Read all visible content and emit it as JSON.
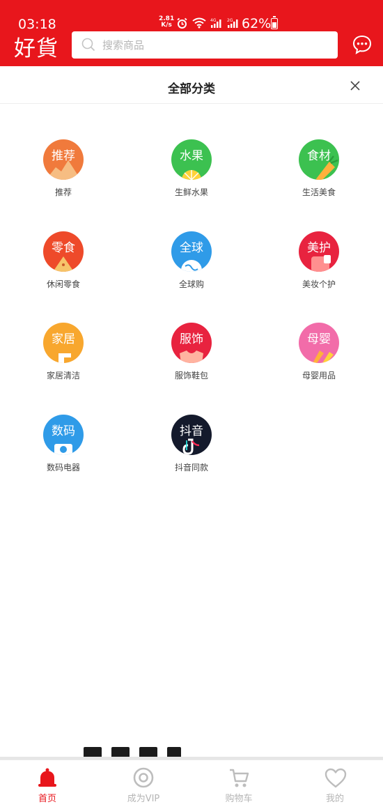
{
  "status_bar": {
    "time": "03:18",
    "speed_value": "2.81",
    "speed_unit": "K/s",
    "network": "4G 2G",
    "battery": "62%"
  },
  "header": {
    "logo": "好貨",
    "search_placeholder": "搜索商品",
    "message_icon": "chat-bubble-icon"
  },
  "panel": {
    "title": "全部分类",
    "close_icon": "close-icon"
  },
  "categories": [
    {
      "icon_text": "推荐",
      "label": "推荐",
      "color": "#f07a3c"
    },
    {
      "icon_text": "水果",
      "label": "生鲜水果",
      "color": "#3cc150"
    },
    {
      "icon_text": "食材",
      "label": "生活美食",
      "color": "#3cc150"
    },
    {
      "icon_text": "零食",
      "label": "休闲零食",
      "color": "#ee4a2a"
    },
    {
      "icon_text": "全球",
      "label": "全球购",
      "color": "#2f9be8"
    },
    {
      "icon_text": "美护",
      "label": "美妆个护",
      "color": "#e8233f"
    },
    {
      "icon_text": "家居",
      "label": "家居清洁",
      "color": "#f8a72e"
    },
    {
      "icon_text": "服饰",
      "label": "服饰鞋包",
      "color": "#e8233f"
    },
    {
      "icon_text": "母婴",
      "label": "母婴用品",
      "color": "#f26ca9"
    },
    {
      "icon_text": "数码",
      "label": "数码电器",
      "color": "#2f9be8"
    },
    {
      "icon_text": "抖音",
      "label": "抖音同款",
      "color": "#141a2c"
    }
  ],
  "tabbar": {
    "items": [
      {
        "label": "首页",
        "icon": "bell-icon",
        "active": true
      },
      {
        "label": "成为VIP",
        "icon": "vip-ring-icon",
        "active": false
      },
      {
        "label": "购物车",
        "icon": "cart-icon",
        "active": false
      },
      {
        "label": "我的",
        "icon": "heart-icon",
        "active": false
      }
    ],
    "active_color": "#e8161c",
    "inactive_color": "#b5b5b5"
  },
  "colors": {
    "brand": "#e8161c"
  }
}
